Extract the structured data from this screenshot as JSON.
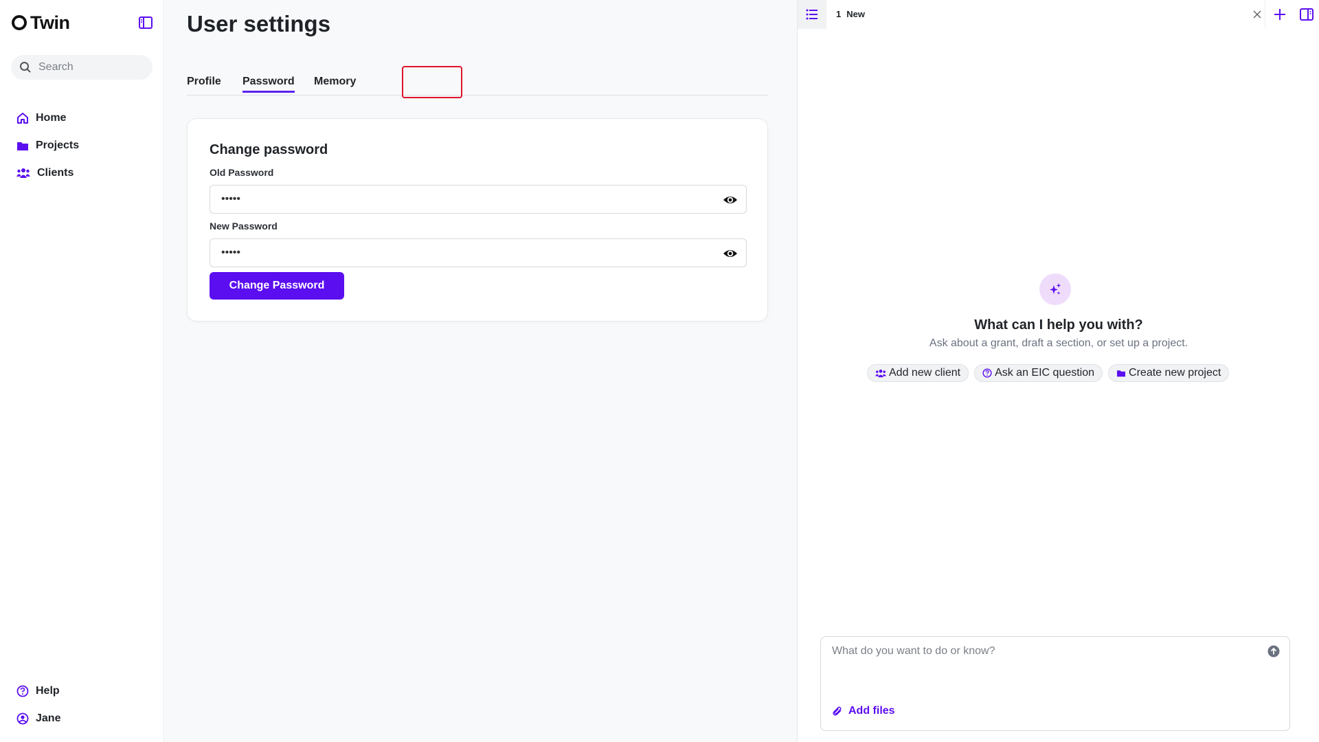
{
  "app": {
    "name": "Twin"
  },
  "sidebar": {
    "search_placeholder": "Search",
    "items": [
      {
        "label": "Home",
        "icon": "home-icon"
      },
      {
        "label": "Projects",
        "icon": "folder-icon"
      },
      {
        "label": "Clients",
        "icon": "users-icon"
      }
    ],
    "bottom": [
      {
        "label": "Help",
        "icon": "help-icon"
      },
      {
        "label": "Jane",
        "icon": "user-avatar-icon"
      }
    ]
  },
  "main": {
    "title": "User settings",
    "tabs": [
      {
        "label": "Profile"
      },
      {
        "label": "Password",
        "active": true
      },
      {
        "label": "Memory"
      }
    ],
    "card": {
      "title": "Change password",
      "old_password_label": "Old Password",
      "old_password_value": "•••••",
      "new_password_label": "New Password",
      "new_password_value": "•••••",
      "button_label": "Change Password"
    }
  },
  "panel": {
    "tab_number": "1",
    "tab_label": "New",
    "hero_title": "What can I help you with?",
    "hero_subtitle": "Ask about a grant, draft a section, or set up a project.",
    "chips": [
      {
        "label": "Add new client",
        "icon": "users-icon"
      },
      {
        "label": "Ask an EIC question",
        "icon": "help-icon"
      },
      {
        "label": "Create new project",
        "icon": "folder-icon"
      }
    ],
    "composer_placeholder": "What do you want to do or know?",
    "add_files_label": "Add files"
  },
  "colors": {
    "accent": "#5b0ef0",
    "highlight": "#e0112b",
    "hero_bg": "#efdcfb"
  }
}
